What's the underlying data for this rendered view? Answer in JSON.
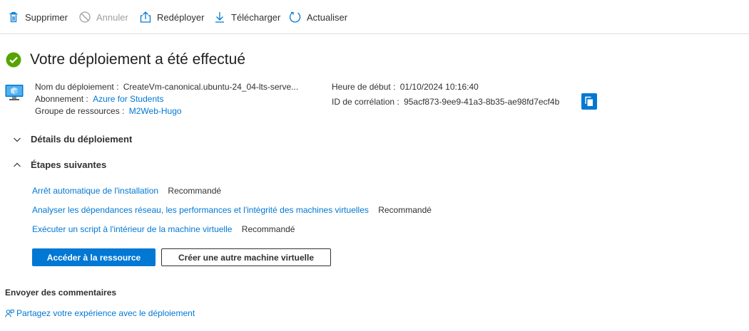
{
  "toolbar": {
    "delete": "Supprimer",
    "cancel": "Annuler",
    "redeploy": "Redéployer",
    "download": "Télécharger",
    "refresh": "Actualiser",
    "icons": [
      "trash-icon",
      "cancel-icon",
      "redeploy-icon",
      "download-icon",
      "refresh-icon"
    ]
  },
  "header": {
    "status_icon": "success-check-icon",
    "title": "Votre déploiement a été effectué"
  },
  "details": {
    "deployment_name_label": "Nom du déploiement :",
    "deployment_name_value": "CreateVm-canonical.ubuntu-24_04-lts-serve...",
    "subscription_label": "Abonnement :",
    "subscription_value": "Azure for Students",
    "resource_group_label": "Groupe de ressources :",
    "resource_group_value": "M2Web-Hugo",
    "start_time_label": "Heure de début :",
    "start_time_value": "01/10/2024 10:16:40",
    "correlation_id_label": "ID de corrélation :",
    "correlation_id_value": "95acf873-9ee9-41a3-8b35-ae98fd7ecf4b"
  },
  "sections": {
    "deployment_details": "Détails du déploiement",
    "next_steps": "Étapes suivantes"
  },
  "next_steps": [
    {
      "label": "Arrêt automatique de l'installation",
      "tag": "Recommandé"
    },
    {
      "label": "Analyser les dépendances réseau, les performances et l'intégrité des machines virtuelles",
      "tag": "Recommandé"
    },
    {
      "label": "Exécuter un script à l'intérieur de la machine virtuelle",
      "tag": "Recommandé"
    }
  ],
  "actions": {
    "go_to_resource": "Accéder à la ressource",
    "create_another_vm": "Créer une autre machine virtuelle"
  },
  "feedback": {
    "title": "Envoyer des commentaires",
    "link": "Partagez votre expérience avec le déploiement"
  },
  "colors": {
    "accent": "#0078d4",
    "success": "#57a300",
    "text": "#323130"
  }
}
